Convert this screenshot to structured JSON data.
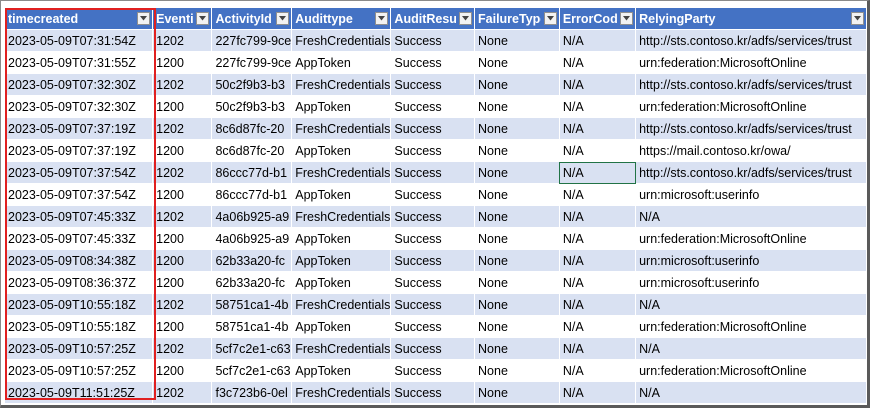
{
  "columns": [
    "timecreated",
    "Eventid",
    "ActivityId",
    "Audittype",
    "AuditResult",
    "FailureType",
    "ErrorCode",
    "RelyingParty"
  ],
  "rows": [
    [
      "2023-05-09T07:31:54Z",
      "1202",
      "227fc799-9ce",
      "FreshCredentials",
      "Success",
      "None",
      "N/A",
      "http://sts.contoso.kr/adfs/services/trust"
    ],
    [
      "2023-05-09T07:31:55Z",
      "1200",
      "227fc799-9ce",
      "AppToken",
      "Success",
      "None",
      "N/A",
      "urn:federation:MicrosoftOnline"
    ],
    [
      "2023-05-09T07:32:30Z",
      "1202",
      "50c2f9b3-b3",
      "FreshCredentials",
      "Success",
      "None",
      "N/A",
      "http://sts.contoso.kr/adfs/services/trust"
    ],
    [
      "2023-05-09T07:32:30Z",
      "1200",
      "50c2f9b3-b3",
      "AppToken",
      "Success",
      "None",
      "N/A",
      "urn:federation:MicrosoftOnline"
    ],
    [
      "2023-05-09T07:37:19Z",
      "1202",
      "8c6d87fc-20",
      "FreshCredentials",
      "Success",
      "None",
      "N/A",
      "http://sts.contoso.kr/adfs/services/trust"
    ],
    [
      "2023-05-09T07:37:19Z",
      "1200",
      "8c6d87fc-20",
      "AppToken",
      "Success",
      "None",
      "N/A",
      "https://mail.contoso.kr/owa/"
    ],
    [
      "2023-05-09T07:37:54Z",
      "1202",
      "86ccc77d-b1",
      "FreshCredentials",
      "Success",
      "None",
      "N/A",
      "http://sts.contoso.kr/adfs/services/trust"
    ],
    [
      "2023-05-09T07:37:54Z",
      "1200",
      "86ccc77d-b1",
      "AppToken",
      "Success",
      "None",
      "N/A",
      "urn:microsoft:userinfo"
    ],
    [
      "2023-05-09T07:45:33Z",
      "1202",
      "4a06b925-a9",
      "FreshCredentials",
      "Success",
      "None",
      "N/A",
      "N/A"
    ],
    [
      "2023-05-09T07:45:33Z",
      "1200",
      "4a06b925-a9",
      "AppToken",
      "Success",
      "None",
      "N/A",
      "urn:federation:MicrosoftOnline"
    ],
    [
      "2023-05-09T08:34:38Z",
      "1200",
      "62b33a20-fc",
      "AppToken",
      "Success",
      "None",
      "N/A",
      "urn:microsoft:userinfo"
    ],
    [
      "2023-05-09T08:36:37Z",
      "1200",
      "62b33a20-fc",
      "AppToken",
      "Success",
      "None",
      "N/A",
      "urn:microsoft:userinfo"
    ],
    [
      "2023-05-09T10:55:18Z",
      "1202",
      "58751ca1-4b",
      "FreshCredentials",
      "Success",
      "None",
      "N/A",
      "N/A"
    ],
    [
      "2023-05-09T10:55:18Z",
      "1200",
      "58751ca1-4b",
      "AppToken",
      "Success",
      "None",
      "N/A",
      "urn:federation:MicrosoftOnline"
    ],
    [
      "2023-05-09T10:57:25Z",
      "1202",
      "5cf7c2e1-c63",
      "FreshCredentials",
      "Success",
      "None",
      "N/A",
      "N/A"
    ],
    [
      "2023-05-09T10:57:25Z",
      "1200",
      "5cf7c2e1-c63",
      "AppToken",
      "Success",
      "None",
      "N/A",
      "urn:federation:MicrosoftOnline"
    ],
    [
      "2023-05-09T11:51:25Z",
      "1202",
      "f3c723b6-0el",
      "FreshCredentials",
      "Success",
      "None",
      "N/A",
      "N/A"
    ]
  ],
  "selected_cell": {
    "row": 6,
    "col": 6
  },
  "colors": {
    "header_bg": "#4472c4",
    "band": "#d9e1f2",
    "highlight": "#e02020",
    "selection": "#217346"
  }
}
